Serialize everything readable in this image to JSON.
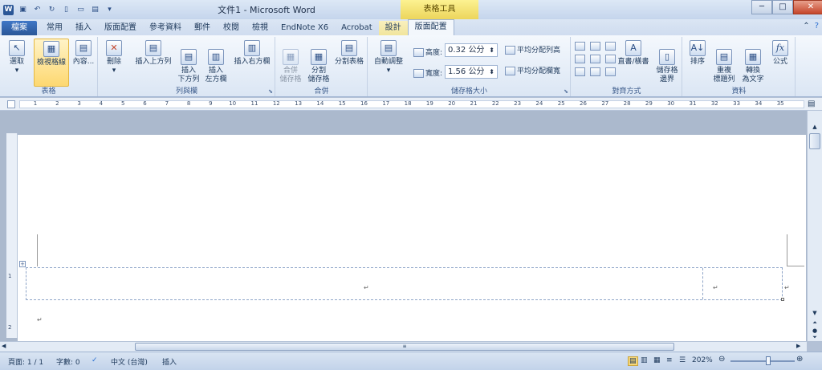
{
  "window": {
    "title": "文件1 - Microsoft Word",
    "context_header": "表格工具",
    "minimize": "─",
    "maximize": "□",
    "close": "✕"
  },
  "tabs": {
    "file": "檔案",
    "home": "常用",
    "insert": "插入",
    "page_layout": "版面配置",
    "references": "參考資料",
    "mailings": "郵件",
    "review": "校閱",
    "view": "檢視",
    "endnote": "EndNote X6",
    "acrobat": "Acrobat",
    "design": "設計",
    "layout": "版面配置"
  },
  "ribbon": {
    "table": {
      "label": "表格",
      "select": "選取",
      "gridlines": "檢視格線",
      "properties": "內容..."
    },
    "rows_cols": {
      "label": "列與欄",
      "delete": "刪除",
      "insert_above": "插入上方列",
      "insert_below": "插入\n下方列",
      "insert_left": "插入\n左方欄",
      "insert_right": "插入右方欄"
    },
    "merge": {
      "label": "合併",
      "merge_cells": "合併\n儲存格",
      "split_cells": "分割\n儲存格",
      "split_table": "分割表格"
    },
    "cell_size": {
      "label": "儲存格大小",
      "autofit": "自動調整",
      "height_label": "高度:",
      "height_value": "0.32 公分",
      "width_label": "寬度:",
      "width_value": "1.56 公分",
      "distribute_rows": "平均分配列高",
      "distribute_cols": "平均分配欄寬"
    },
    "alignment": {
      "label": "對齊方式",
      "text_direction": "直書/橫書",
      "cell_margins": "儲存格\n邊界"
    },
    "data": {
      "label": "資料",
      "sort": "排序",
      "repeat_header": "重複\n標題列",
      "convert": "轉換\n為文字",
      "formula": "公式"
    }
  },
  "ruler": {
    "ticks": [
      "1",
      "2",
      "3",
      "4",
      "5",
      "6",
      "7",
      "8",
      "9",
      "10",
      "11",
      "12",
      "13",
      "14",
      "15",
      "16",
      "17",
      "18",
      "19",
      "20",
      "21",
      "22",
      "23",
      "24",
      "25",
      "26",
      "27",
      "28",
      "29",
      "30",
      "31",
      "32",
      "33",
      "34",
      "35"
    ],
    "vticks": [
      "1",
      "2"
    ]
  },
  "status": {
    "page": "頁面: 1 / 1",
    "words": "字數: 0",
    "language": "中文 (台灣)",
    "mode": "插入",
    "zoom": "202%"
  }
}
